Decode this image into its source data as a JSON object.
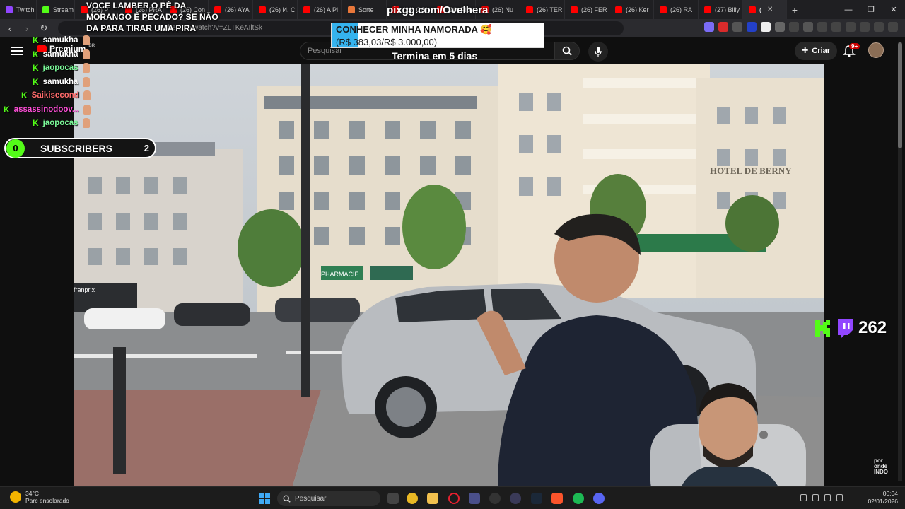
{
  "browser": {
    "tabs": [
      {
        "label": "Twitch",
        "color": "#9146ff"
      },
      {
        "label": "Stream",
        "color": "#53fc18"
      },
      {
        "label": "(26) P",
        "color": "#ff0000"
      },
      {
        "label": "(26) PRA",
        "color": "#ff0000"
      },
      {
        "label": "(26) Con",
        "color": "#ff0000"
      },
      {
        "label": "(26) AYA",
        "color": "#ff0000"
      },
      {
        "label": "(26) И. С",
        "color": "#ff0000"
      },
      {
        "label": "(26) A Pi",
        "color": "#ff0000"
      },
      {
        "label": "Sorte",
        "color": "#e8773a"
      },
      {
        "label": "(26) COI",
        "color": "#ff0000"
      },
      {
        "label": "(26) FIU",
        "color": "#ff0000"
      },
      {
        "label": "(26) Nu",
        "color": "#ff0000"
      },
      {
        "label": "(26) TER",
        "color": "#ff0000"
      },
      {
        "label": "(26) FER",
        "color": "#ff0000"
      },
      {
        "label": "(26) Ker",
        "color": "#ff0000"
      },
      {
        "label": "(26) RA",
        "color": "#ff0000"
      },
      {
        "label": "(27) Billy",
        "color": "#ff0000"
      },
      {
        "label": "(",
        "color": "#ff0000",
        "active": true
      }
    ],
    "new_tab": "+",
    "url": "ube.com/watch?v=ZLTKeAIltSk",
    "window_controls": [
      "—",
      "❐",
      "✕"
    ]
  },
  "youtube": {
    "search_placeholder": "Pesquisar",
    "premium": "Premium",
    "premium_region": "BR",
    "create_label": "Criar",
    "notifications": "9+"
  },
  "overlay": {
    "donation_text": "VOCE LAMBER O PÉ DA MORANGO É PECADO? SE NÃO DA PARA TIRAR UMA PIRA",
    "pix_url": "pixgg.com/Ovelhera",
    "goal_title": "CONHECER MINHA NAMORADA 🥰",
    "goal_amount": "(R$ 383,03/R$ 3.000,00)",
    "goal_progress": 0.1277,
    "ends_in": "Termina em 5 dias",
    "chat": [
      {
        "user": "samukha",
        "color": "#ffffff"
      },
      {
        "user": "samukha",
        "color": "#ffffff"
      },
      {
        "user": "jaopocas",
        "color": "#7cfc9a"
      },
      {
        "user": "samukha",
        "color": "#ffffff"
      },
      {
        "user": "Saikisecond",
        "color": "#ff6b6b"
      },
      {
        "user": "assassinodoov...",
        "color": "#ff4fd8"
      },
      {
        "user": "jaopocas",
        "color": "#7cfc9a"
      }
    ],
    "subs_count": "0",
    "subs_label": "SUBSCRIBERS",
    "subs_goal": "2",
    "viewers": "262",
    "watermark": "por onde INDO"
  },
  "taskbar": {
    "temp": "34°C",
    "weather": "Parc ensolarado",
    "search": "Pesquisar",
    "time": "00:04",
    "date": "02/01/2026"
  }
}
